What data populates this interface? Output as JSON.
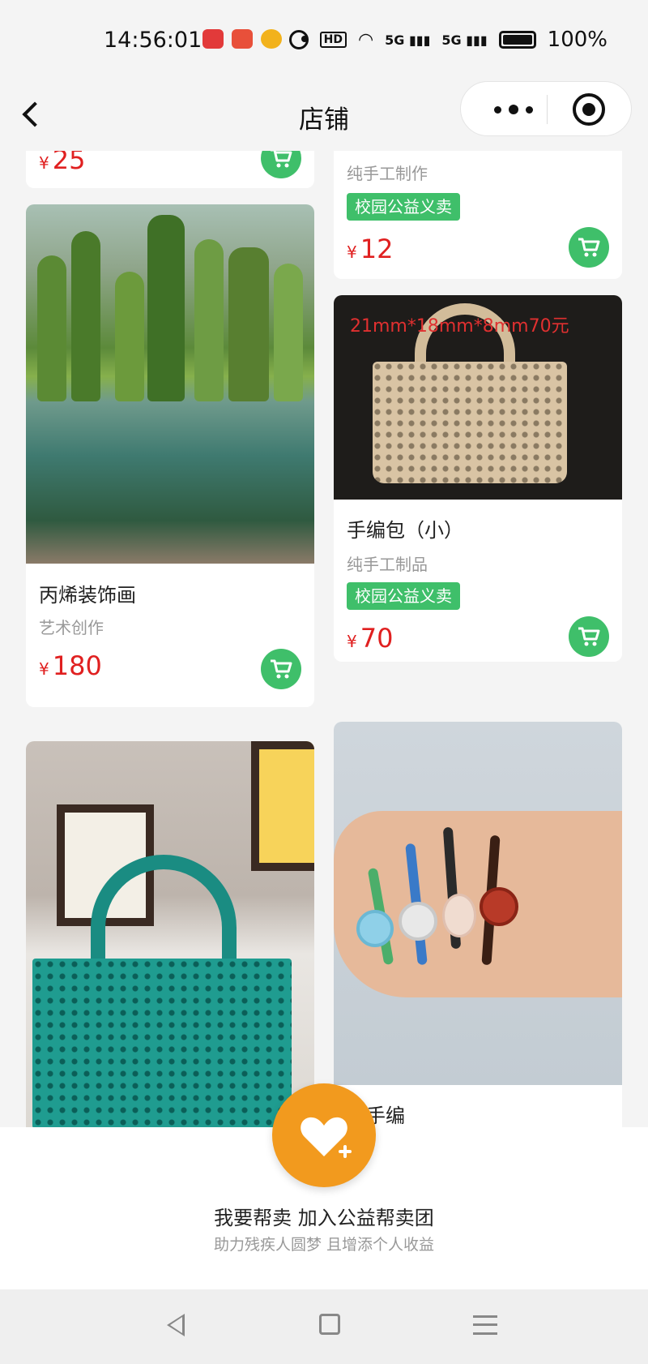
{
  "status_bar": {
    "time": "14:56:01",
    "network_1": "5G",
    "network_2": "5G",
    "battery": "100%"
  },
  "nav": {
    "title": "店铺"
  },
  "products": [
    {
      "title": "",
      "subtitle": "",
      "tag": "",
      "price": "25",
      "currency": "¥"
    },
    {
      "title": "",
      "subtitle": "纯手工制作",
      "tag": "校园公益义卖",
      "price": "12",
      "currency": "¥"
    },
    {
      "title": "丙烯装饰画",
      "subtitle": "艺术创作",
      "tag": "",
      "price": "180",
      "currency": "¥"
    },
    {
      "image_text": "21mm*18mm*8mm70元",
      "title": "手编包（小）",
      "subtitle": "纯手工制品",
      "tag": "校园公益义卖",
      "price": "70",
      "currency": "¥"
    },
    {
      "title": "",
      "subtitle": "",
      "tag": "",
      "price": "",
      "currency": ""
    },
    {
      "title": "翠手编",
      "subtitle": "",
      "tag": "",
      "price": "",
      "currency": ""
    }
  ],
  "promo": {
    "title": "我要帮卖 加入公益帮卖团",
    "subtitle": "助力残疾人圆梦 且增添个人收益"
  },
  "colors": {
    "accent_green": "#3fbf6a",
    "price_red": "#e02020",
    "orange": "#f29a1e"
  }
}
